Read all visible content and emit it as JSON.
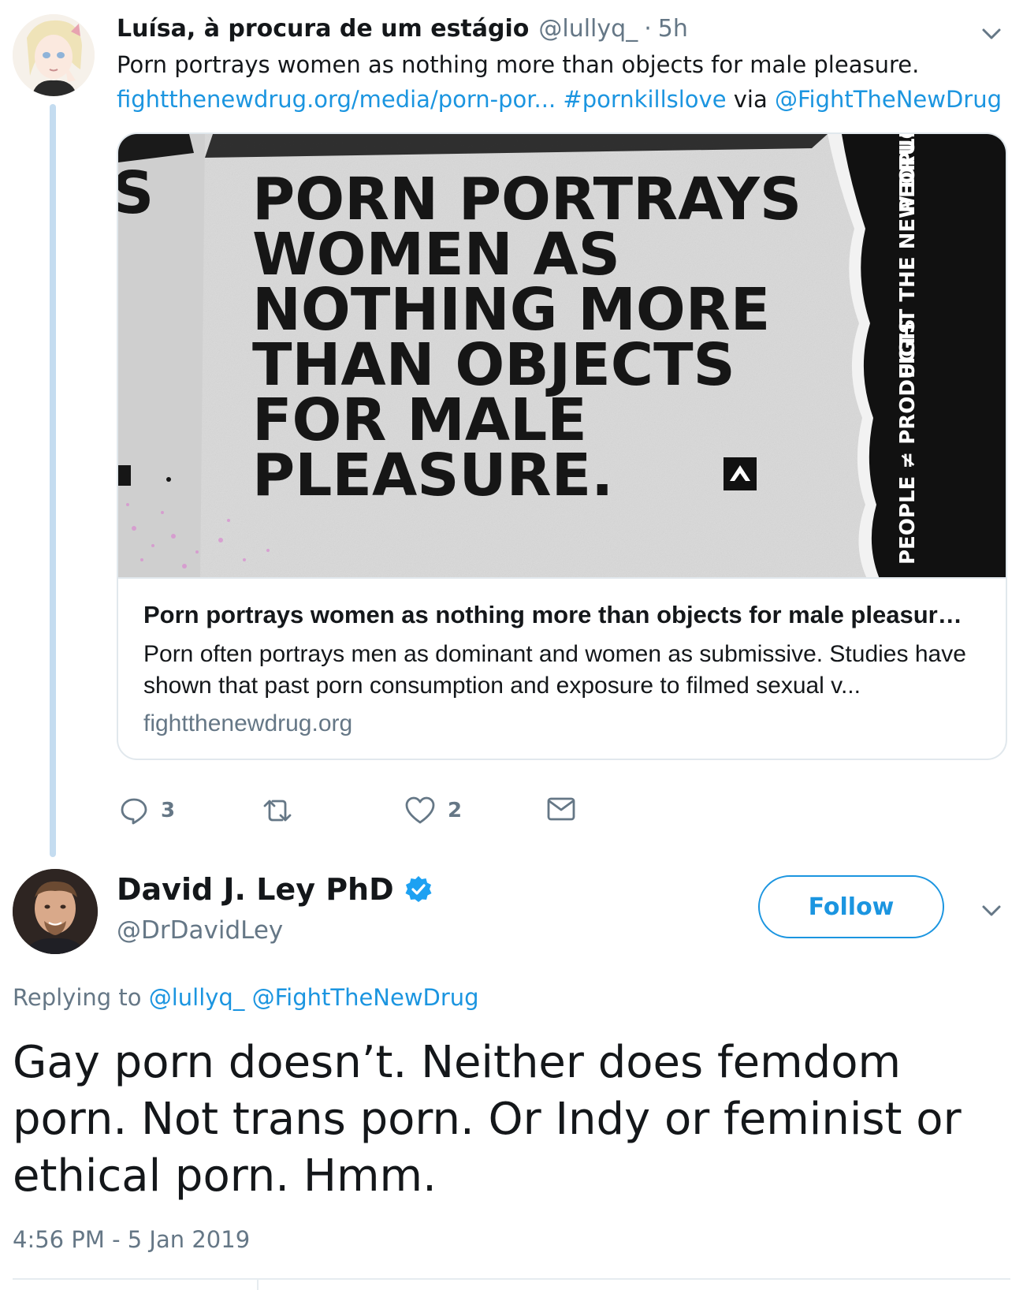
{
  "parent_tweet": {
    "display_name": "Luísa, à procura de um estágio",
    "handle": "@lullyq_",
    "separator": "·",
    "time": "5h",
    "text": "Porn portrays women as nothing more than objects for male pleasure.",
    "link_url": "fightthenewdrug.org/media/porn-por...",
    "hashtag": "#pornkillslove",
    "via_word": "via",
    "via_handle": "@FightTheNewDrug",
    "card": {
      "image_headline_lines": [
        "PORN PORTRAYS",
        "WOMEN AS",
        "NOTHING MORE",
        "THAN OBJECTS",
        "FOR MALE",
        "PLEASURE."
      ],
      "image_side_texts": [
        "PEOPLE ≠ PRODUCTS",
        "FIGHT THE NEW DRUG",
        "PEOPLE PRODU"
      ],
      "title": "Porn portrays women as nothing more than objects for male pleasur…",
      "description": "Porn often portrays men as dominant and women as submissive. Studies have shown that past porn consumption and exposure to filmed sexual v...",
      "domain": "fightthenewdrug.org"
    },
    "actions": {
      "reply_count": "3",
      "retweet_count": "",
      "like_count": "2"
    }
  },
  "main_tweet": {
    "display_name": "David J. Ley PhD",
    "handle": "@DrDavidLey",
    "follow_label": "Follow",
    "replying_prefix": "Replying to",
    "replying_handle_1": "@lullyq_",
    "replying_handle_2": "@FightTheNewDrug",
    "text": "Gay porn doesn’t. Neither does femdom porn. Not trans porn. Or Indy or feminist or ethical porn. Hmm.",
    "timestamp": "4:56 PM - 5 Jan 2019"
  },
  "colors": {
    "link_blue": "#1b95e0",
    "muted_gray": "#657786",
    "text_dark": "#14171a",
    "thread_line": "#c4dcf0",
    "border": "#e1e8ed"
  },
  "icons": [
    "chevron-down-icon",
    "reply-icon",
    "retweet-icon",
    "like-icon",
    "direct-message-icon",
    "verified-badge-icon"
  ]
}
